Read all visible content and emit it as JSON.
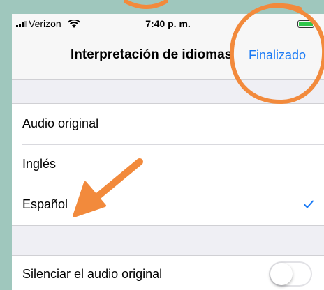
{
  "status_bar": {
    "carrier": "Verizon",
    "time": "7:40 p. m.",
    "battery_color": "#2fc64a"
  },
  "nav": {
    "title": "Interpretación de idiomas",
    "done_label": "Finalizado"
  },
  "language_options": [
    {
      "label": "Audio original",
      "selected": false
    },
    {
      "label": "Inglés",
      "selected": false
    },
    {
      "label": "Español",
      "selected": true
    }
  ],
  "mute_original": {
    "label": "Silenciar el audio original",
    "enabled": false
  },
  "colors": {
    "accent": "#1a7af5",
    "annotation": "#f28a3c",
    "background": "#9fc7bd"
  }
}
